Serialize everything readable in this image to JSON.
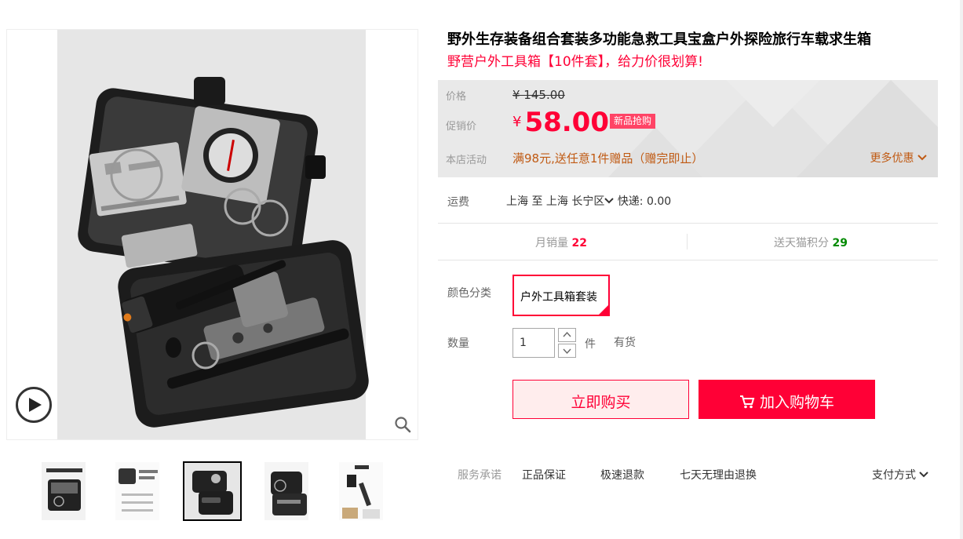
{
  "product": {
    "title": "野外生存装备组合套装多功能急救工具宝盒户外探险旅行车载求生箱",
    "subtitle": "野营户外工具箱【10件套】，给力价很划算!"
  },
  "price": {
    "label": "价格",
    "original": "¥ 145.00",
    "promo_label": "促销价",
    "currency": "¥",
    "promo": "58.00",
    "badge": "新品抢购",
    "activity_label": "本店活动",
    "activity_text": "满98元,送任意1件赠品（赠完即止）",
    "more_deals": "更多优惠"
  },
  "shipping": {
    "label": "运费",
    "from": "上海",
    "to_word": "至",
    "to": "上海 长宁区",
    "method": "快递: 0.00"
  },
  "stats": {
    "monthly_sales_label": "月销量",
    "monthly_sales": "22",
    "points_label": "送天猫积分",
    "points": "29"
  },
  "sku": {
    "color_label": "颜色分类",
    "selected": "户外工具箱套装"
  },
  "quantity": {
    "label": "数量",
    "value": "1",
    "unit": "件",
    "stock": "有货"
  },
  "buttons": {
    "buy_now": "立即购买",
    "add_cart": "加入购物车"
  },
  "service": {
    "label": "服务承诺",
    "items": [
      "正品保证",
      "极速退款",
      "七天无理由退换"
    ],
    "payment": "支付方式"
  },
  "icons": {
    "play": "play-icon",
    "zoom": "magnifier-icon",
    "cart": "cart-icon",
    "chevron": "chevron-down-icon"
  },
  "colors": {
    "accent": "#ff0036",
    "activity": "#c05a13",
    "green": "#008a00"
  }
}
